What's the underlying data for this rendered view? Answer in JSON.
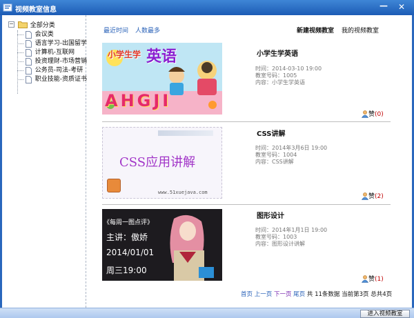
{
  "window": {
    "title": "视频教室信息",
    "min_symbol": "—",
    "close_symbol": "✕"
  },
  "tree": {
    "root_label": "全部分类",
    "items": [
      {
        "label": "会议类"
      },
      {
        "label": "语言学习-出国留学"
      },
      {
        "label": "计算机-互联网"
      },
      {
        "label": "投资理财-市场营销"
      },
      {
        "label": "公务员-司法-考研"
      },
      {
        "label": "职业技能-资质证书"
      }
    ]
  },
  "main": {
    "sort_recent": "最近时间",
    "sort_popular": "人数最多",
    "new_classroom": "新建视频教室",
    "my_classroom": "我的视频教室"
  },
  "cards": [
    {
      "title": "小学生学英语",
      "time": "时间：2014-03-10 19:00",
      "room": "教室号码：1005",
      "content": "内容：小学生学英语",
      "like_label": "赞",
      "like_count": "(0)",
      "thumb_text_top": "小学生学",
      "thumb_text_big": "英语",
      "thumb_letters": "AHGJI"
    },
    {
      "title": "CSS讲解",
      "time": "时间：2014年3月6日  19:00",
      "room": "教室号码：1004",
      "content": "内容：CSS讲解",
      "like_label": "赞",
      "like_count": "(2)",
      "thumb_main": "CSS应用讲解",
      "thumb_url": "www.51xuejava.com"
    },
    {
      "title": "图形设计",
      "time": "时间：2014年1月1日  19:00",
      "room": "教室号码：1003",
      "content": "内容：图形设计讲解",
      "like_label": "赞",
      "like_count": "(1)",
      "thumb_l1": "《每周一图点评》",
      "thumb_l2": "主讲：傲娇",
      "thumb_l3": "2014/01/01",
      "thumb_l4": "周三19:00"
    }
  ],
  "pager": {
    "first": "首页",
    "prev": "上一页",
    "next": "下一页",
    "last": "尾页",
    "summary_1": "共",
    "total": "11条数据",
    "current": "当前第3页",
    "pages": "总共4页"
  },
  "bottom": {
    "enter_button": "进入视频教室"
  },
  "colors": {
    "title_bar": "#2a67bd",
    "link": "#2a62b8",
    "like_count": "#c00000"
  }
}
